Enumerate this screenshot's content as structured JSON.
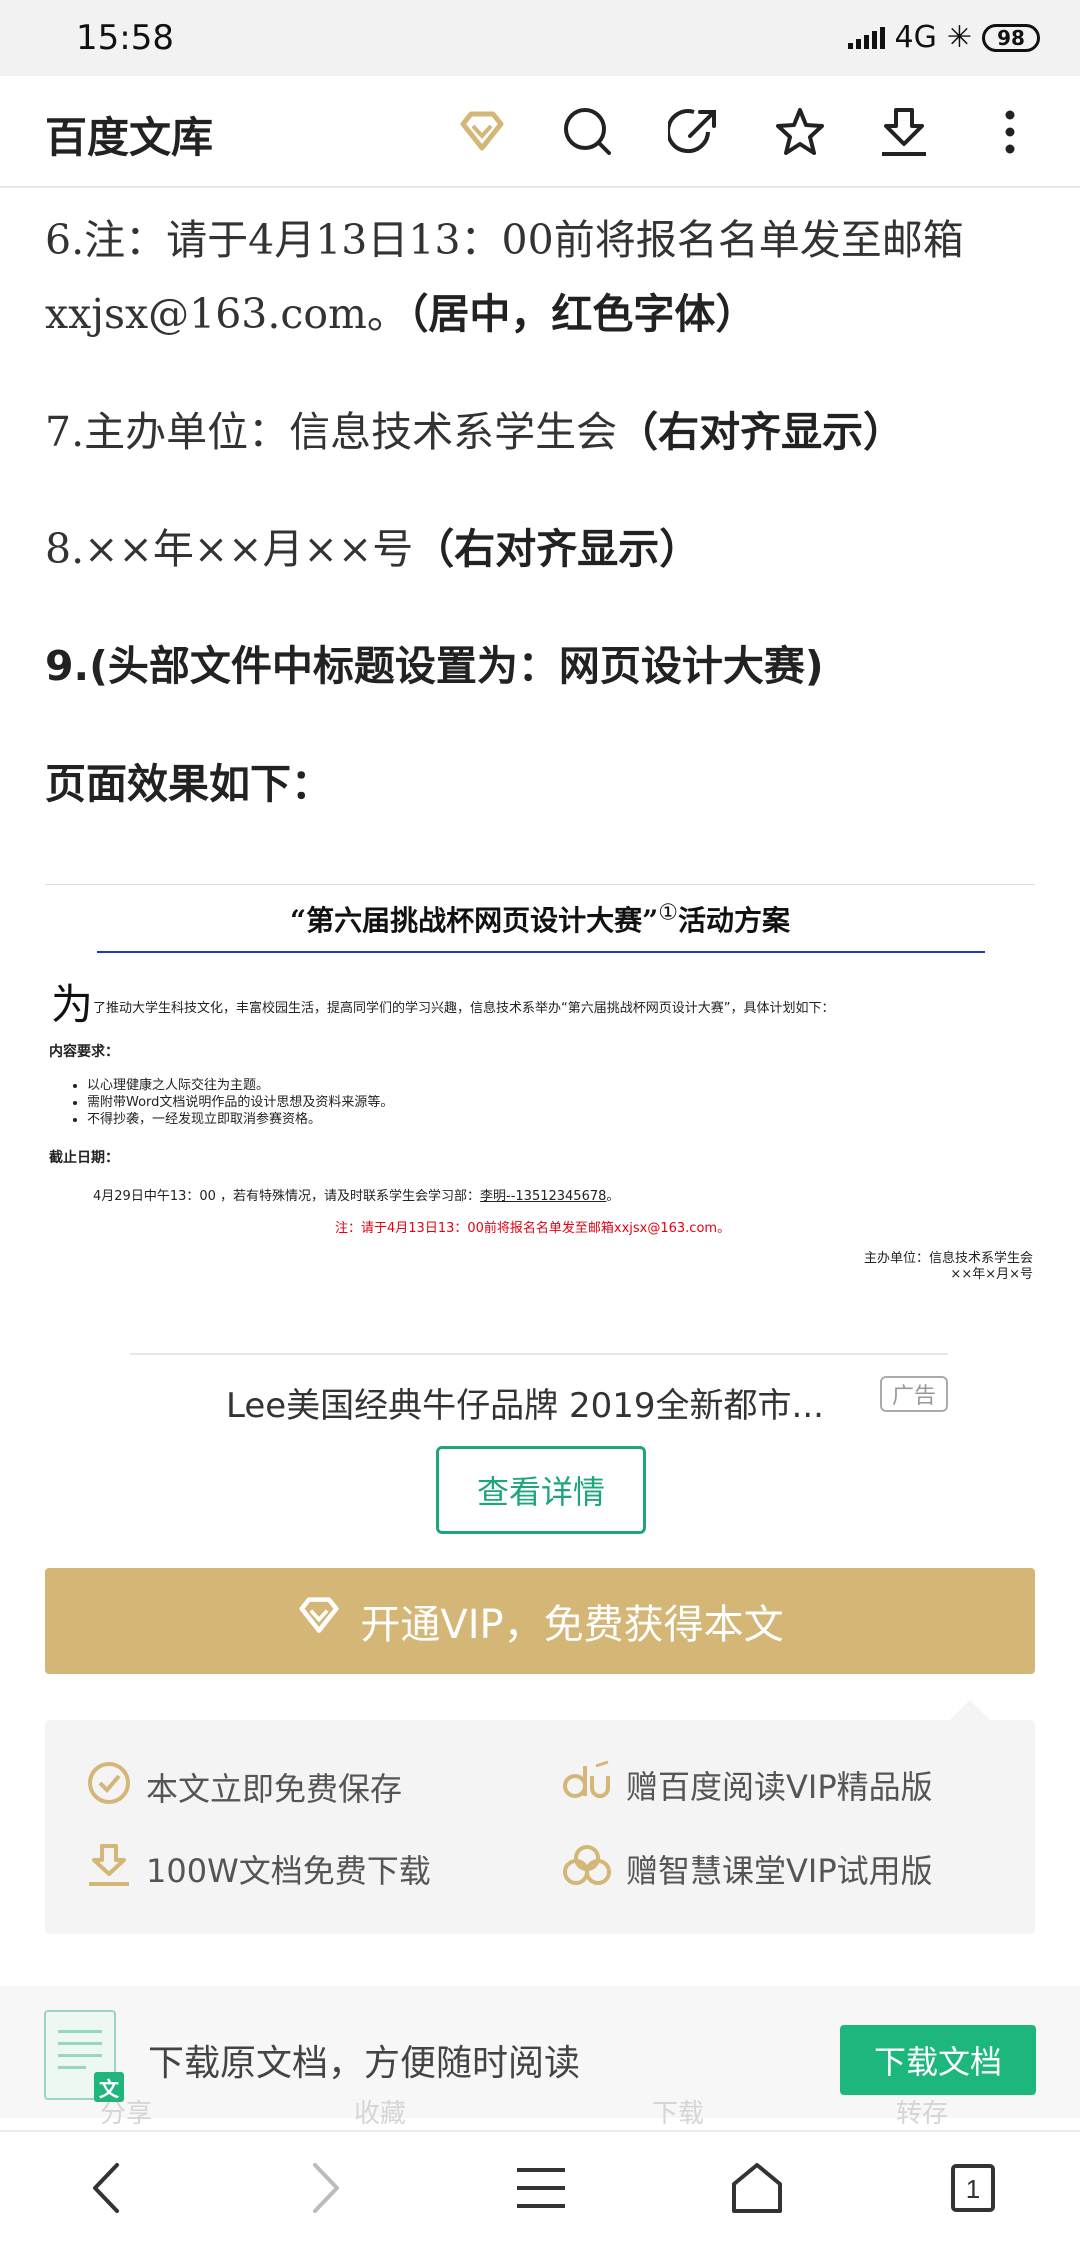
{
  "status_bar": {
    "time": "15:58",
    "network": "4G",
    "battery": "98"
  },
  "header": {
    "title": "百度文库",
    "icons": [
      "vip-diamond-icon",
      "search-icon",
      "share-icon",
      "star-icon",
      "download-icon",
      "more-icon"
    ]
  },
  "document": {
    "line6_a": "6.注：请于4月13日13：00前将报名名单发至邮箱",
    "line6_b": "xxjsx@163.com。",
    "line6_b_bold": "（居中，红色字体）",
    "line7": "7.主办单位：信息技术系学生会",
    "line7_bold": "（右对齐显示）",
    "line8": "8.××年××月××号",
    "line8_bold": "（右对齐显示）",
    "line9": "9.(头部文件中标题设置为：网页设计大赛)",
    "effect_heading": "页面效果如下："
  },
  "preview": {
    "title": "“第六届挑战杯网页设计大赛”",
    "title_sup": "①",
    "title_tail": "活动方案",
    "drop_cap": "为",
    "intro": "了推动大学生科技文化，丰富校园生活，提高同学们的学习兴趣，信息技术系举办“第六届挑战杯网页设计大赛”，具体计划如下：",
    "requirements_heading": "内容要求：",
    "requirements": [
      "以心理健康之人际交往为主题。",
      "需附带Word文档说明作品的设计思想及资料来源等。",
      "不得抄袭，一经发现立即取消参赛资格。"
    ],
    "deadline_heading": "截止日期：",
    "deadline_text": "4月29日中午13：00 ，若有特殊情况，请及时联系学生会学习部：",
    "deadline_contact": "李明--13512345678",
    "deadline_end": "。",
    "red_note": "注：请于4月13日13：00前将报名名单发至邮箱xxjsx@163.com。",
    "organizer": "主办单位：信息技术系学生会",
    "date": "××年×月×号"
  },
  "ad": {
    "title": "Lee美国经典牛仔品牌 2019全新都市...",
    "badge": "广告",
    "button": "查看详情"
  },
  "vip": {
    "button": "开通VIP，免费获得本文",
    "benefits": [
      "本文立即免费保存",
      "赠百度阅读VIP精品版",
      "100W文档免费下载",
      "赠智慧课堂VIP试用版"
    ]
  },
  "download_bar": {
    "text": "下载原文档，方便随时阅读",
    "button": "下载文档",
    "doc_badge": "文",
    "ghost_labels": [
      "分享",
      "收藏",
      "下载",
      "转存"
    ]
  },
  "nav": {
    "tab_count": "1"
  },
  "colors": {
    "accent_gold": "#d4b677",
    "accent_green": "#1db67d",
    "red": "#e60012",
    "rule_blue": "#1f3bb3"
  }
}
